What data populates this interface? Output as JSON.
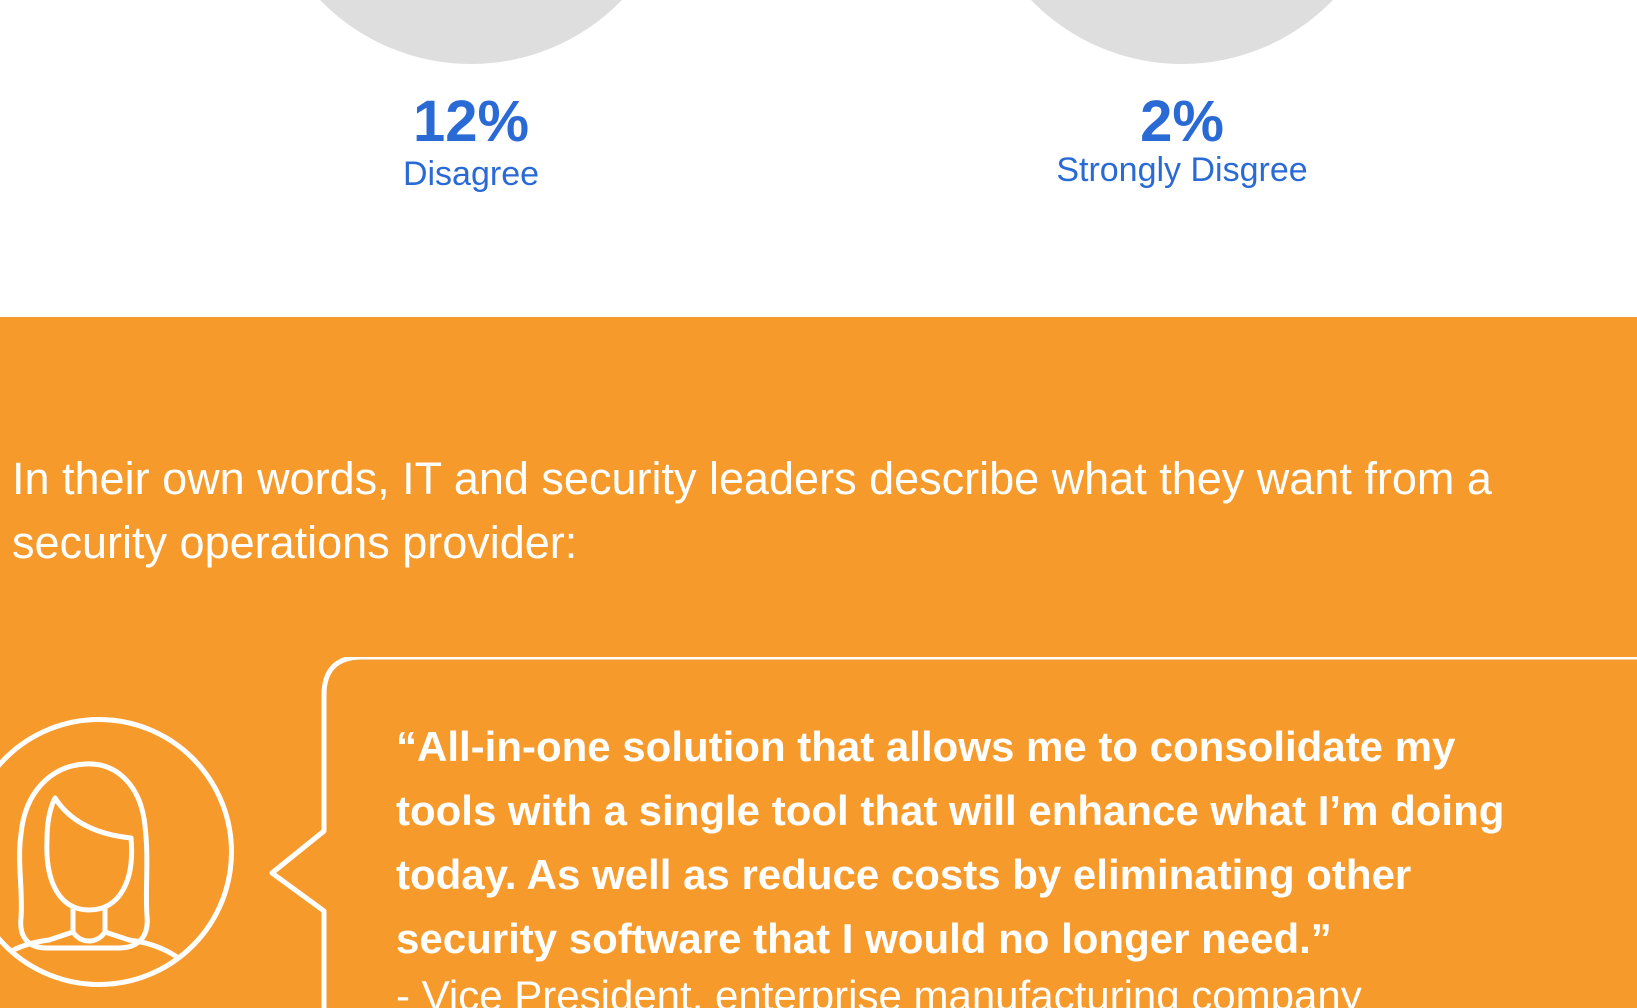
{
  "colors": {
    "accent_blue": "#2a6ad4",
    "orange": "#f79a2c",
    "donut_gray": "#dedede",
    "white": "#ffffff"
  },
  "stats": [
    {
      "value": "12%",
      "label": "Disagree"
    },
    {
      "value": "2%",
      "label": "Strongly Disgree"
    }
  ],
  "quote_section": {
    "intro": "In their own words, IT and security leaders describe what they want from a security operations provider:",
    "quote_lines": [
      "“All-in-one solution that allows me to consolidate my",
      "tools with a single tool that will enhance what I’m doing",
      "today. As well as reduce costs by eliminating other",
      "security software that I would no longer need.”"
    ],
    "attribution": "- Vice President, enterprise manufacturing company",
    "avatar_icon": "woman-avatar-icon",
    "bubble_icon": "speech-bubble-icon"
  }
}
